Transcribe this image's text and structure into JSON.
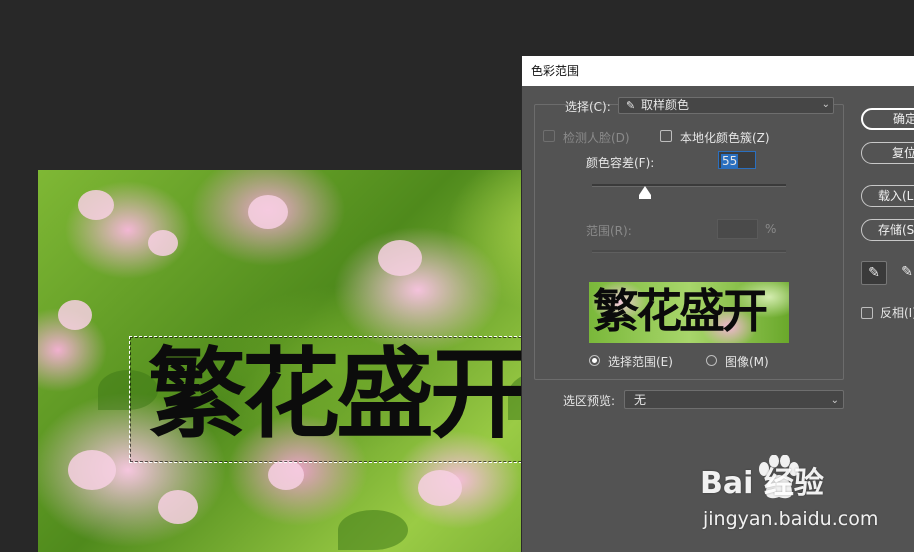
{
  "canvas": {
    "text": "繁花盛开"
  },
  "dialog": {
    "title": "色彩范围",
    "select_label": "选择(C):",
    "select_value": "取样颜色",
    "detect_faces_label": "检测人脸(D)",
    "localized_clusters_label": "本地化颜色簇(Z)",
    "fuzziness_label": "颜色容差(F):",
    "fuzziness_value": "55",
    "range_label": "范围(R):",
    "range_unit": "%",
    "preview_text": "繁花盛开",
    "radio_selection_label": "选择范围(E)",
    "radio_image_label": "图像(M)",
    "selection_preview_label": "选区预览:",
    "selection_preview_value": "无",
    "buttons": {
      "ok": "确定",
      "reset": "复位",
      "load": "载入(L)...",
      "save": "存储(S)..."
    },
    "invert_label": "反相(I)",
    "accent_color": "#2a6fbf"
  },
  "watermark": {
    "logo": "Bai  经验",
    "url": "jingyan.baidu.com"
  }
}
